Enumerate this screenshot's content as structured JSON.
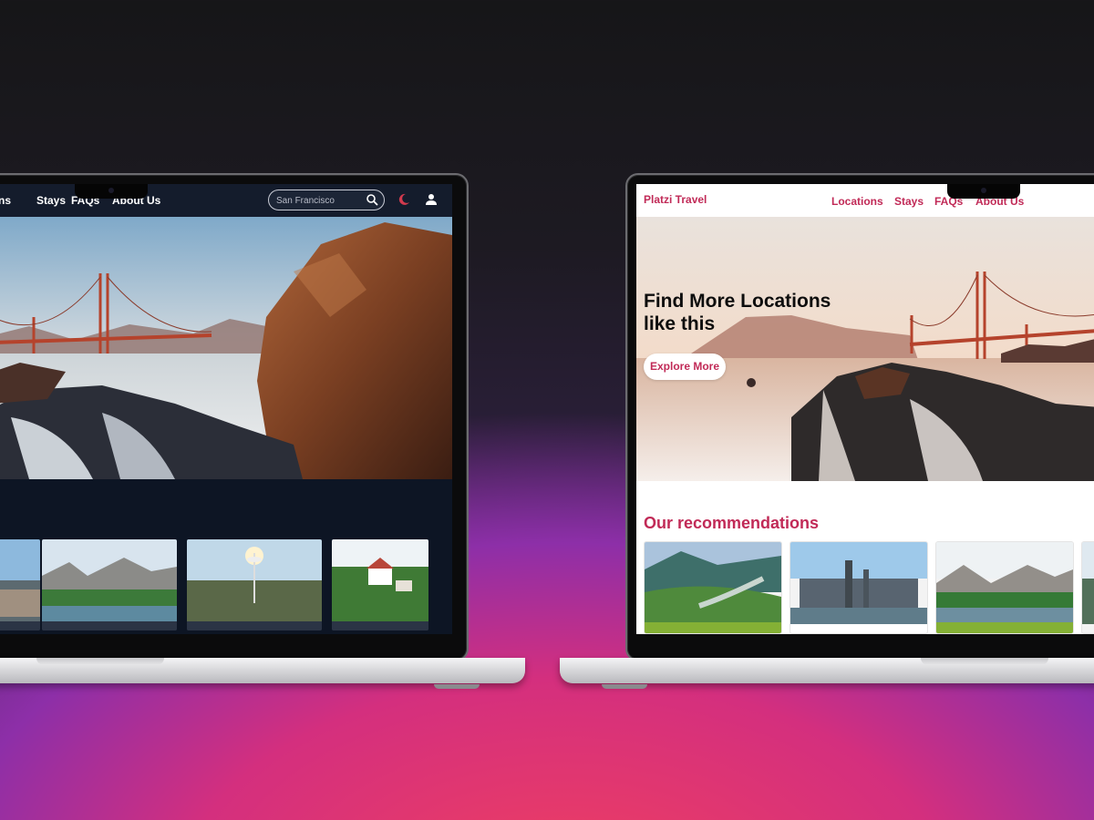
{
  "left_site": {
    "nav": {
      "items": [
        "ns",
        "Stays",
        "FAQs",
        "About Us"
      ]
    },
    "search": {
      "value": "",
      "placeholder": "San Francisco"
    },
    "colors": {
      "background": "#0d1524",
      "nav": "#141c2c",
      "accent": "#d23a4e"
    },
    "icons": [
      "search-icon",
      "moon-icon",
      "user-icon"
    ],
    "cards": [
      "city-coast",
      "mountain-valley",
      "space-needle-city",
      "village-church"
    ]
  },
  "right_site": {
    "brand": "Platzi Travel",
    "nav": {
      "items": [
        "Locations",
        "Stays",
        "FAQs",
        "About Us"
      ]
    },
    "hero": {
      "title_line1": "Find More Locations",
      "title_line2": "like this",
      "button": "Explore More"
    },
    "recommendations_title": "Our recommendations",
    "colors": {
      "brand": "#c12a57",
      "background": "#ffffff"
    },
    "cards": [
      "fjord-valley",
      "city-skyline",
      "mountain-valley",
      "partial-card"
    ]
  }
}
